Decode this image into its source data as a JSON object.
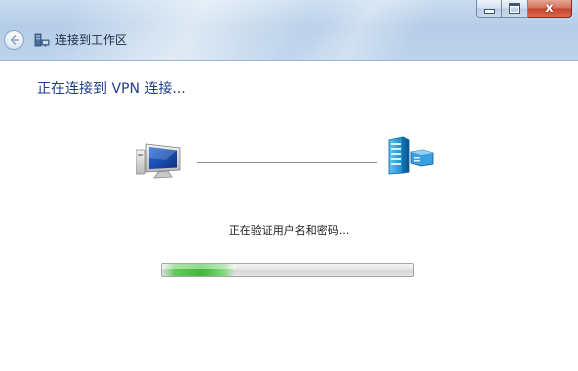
{
  "window": {
    "title": "连接到工作区",
    "controls": {
      "minimize_icon": "minimize-icon",
      "maximize_icon": "maximize-icon",
      "close_glyph": "x"
    },
    "back_icon": "back-arrow-icon",
    "app_icon": "network-icon"
  },
  "content": {
    "heading": "正在连接到 VPN 连接...",
    "status": "正在验证用户名和密码...",
    "local_icon": "computer-icon",
    "remote_icon": "server-icon",
    "progress_fraction": 0.29
  },
  "colors": {
    "heading": "#1f3c8e",
    "progress_fill": "#3fb837",
    "close_button": "#c4472e"
  }
}
